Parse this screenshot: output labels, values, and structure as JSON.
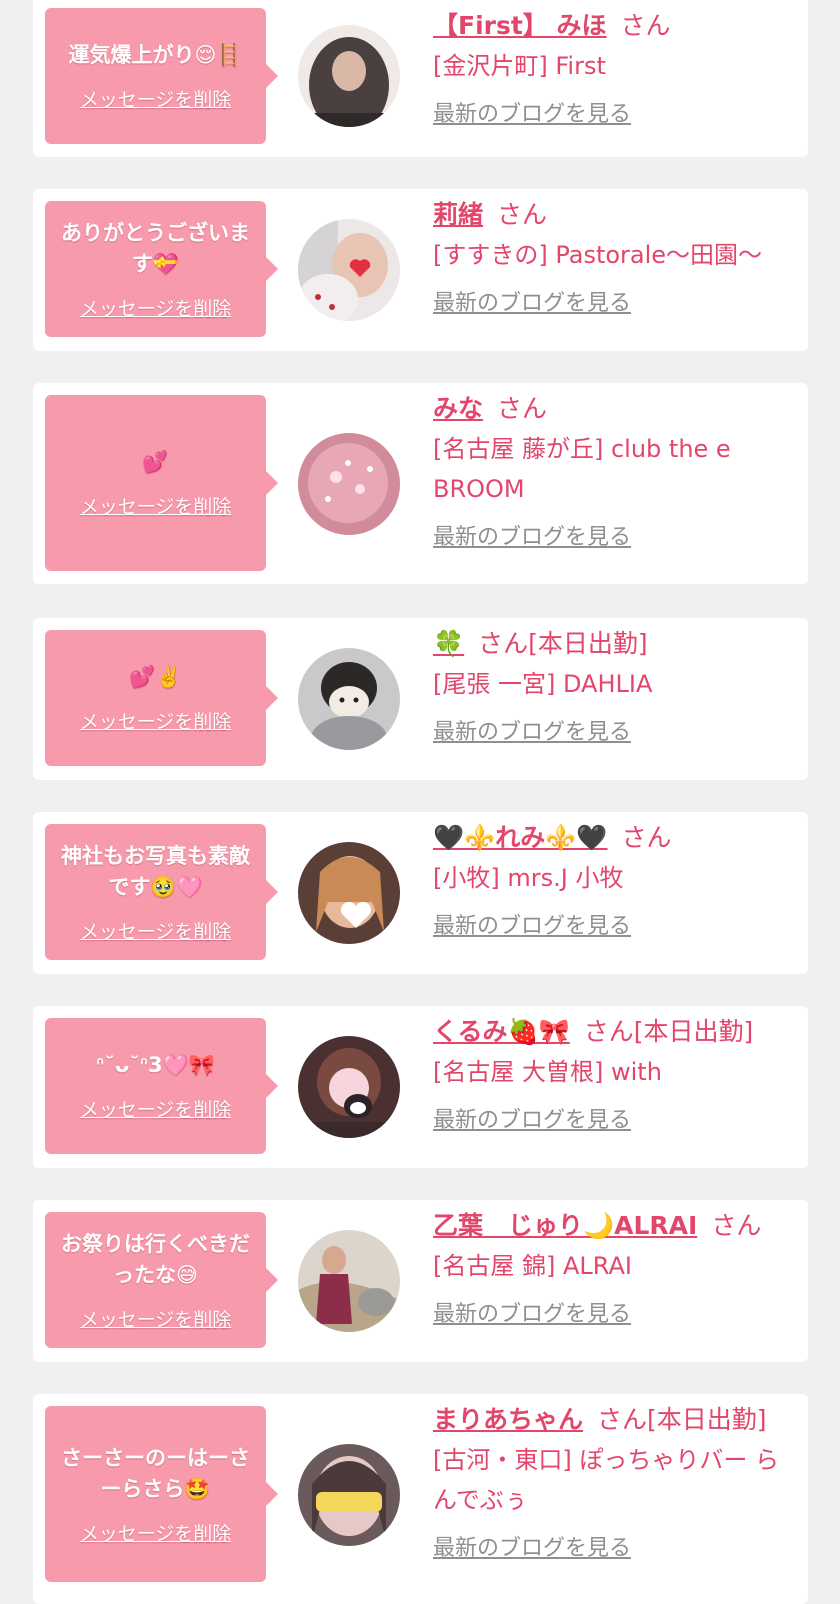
{
  "delete_label": "メッセージを削除",
  "blog_label": "最新のブログを見る",
  "san_label": "さん",
  "colors": {
    "bubble": "#f79aab",
    "accent": "#e2466b",
    "link_gray": "#8f8f8f",
    "page_bg": "#f1f0f1"
  },
  "cards": [
    {
      "message": "運気爆上がり😌🪜",
      "name": "【First】 みほ",
      "suffix": "",
      "shop": "[金沢片町] First"
    },
    {
      "message": "ありがとうございます💝",
      "name": "莉緒",
      "suffix": "",
      "shop": "[すすきの] Pastorale〜田園〜"
    },
    {
      "message": "💕",
      "name": "みな",
      "suffix": "",
      "shop": "[名古屋 藤が丘] club the eBROOM"
    },
    {
      "message": "💕✌️",
      "name": "🍀",
      "suffix": "[本日出勤]",
      "shop": "[尾張 一宮] DAHLIA"
    },
    {
      "message": "神社もお写真も素敵です🥹🩷",
      "name": "🖤⚜️れみ⚜️🖤",
      "suffix": "",
      "shop": "[小牧] mrs.J 小牧"
    },
    {
      "message": "ᐢ˘ᴗ˘ᐢ3🩷🎀",
      "name": "くるみ🍓🎀",
      "suffix": "[本日出勤]",
      "shop": "[名古屋 大曽根] with"
    },
    {
      "message": "お祭りは行くべきだったな😅",
      "name": "乙葉　じゅり🌙ALRAI",
      "suffix": "",
      "shop": "[名古屋 錦] ALRAI"
    },
    {
      "message": "さーさーのーはーさーらさら🤩",
      "name": "まりあちゃん",
      "suffix": "[本日出勤]",
      "shop": "[古河・東口] ぽっちゃりバー らんでぶぅ"
    }
  ]
}
